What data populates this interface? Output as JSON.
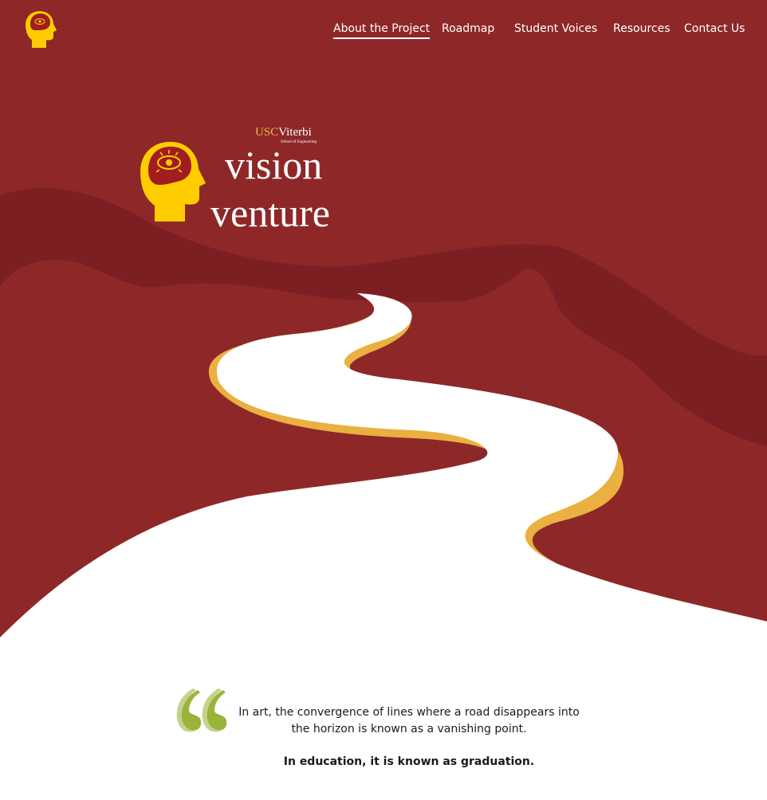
{
  "colors": {
    "background": "#8e2828",
    "hills": "#7c1f22",
    "road": "#ffffff",
    "road_edge": "#eab040",
    "head": "#ffcc00",
    "brain": "#a11d22",
    "quote_mark": "#9ab33a",
    "quote_mark_back": "#c4d28c"
  },
  "nav": {
    "logo_icon": "head-with-eye-icon",
    "links": [
      "About the Project",
      "Roadmap",
      "Student Voices",
      "Resources",
      "Contact Us"
    ],
    "active": "About the Project"
  },
  "brand": {
    "usc": "USC",
    "viterbi": "Viterbi",
    "school": "School of Engineering",
    "word_1": "vision",
    "word_2": "venture"
  },
  "quote": {
    "icon": "quotation-mark-icon",
    "line_1": "In art, the convergence of lines where a road disappears into",
    "line_2": "the horizon is known as a vanishing point.",
    "emphasis": "In education, it is known as graduation."
  }
}
